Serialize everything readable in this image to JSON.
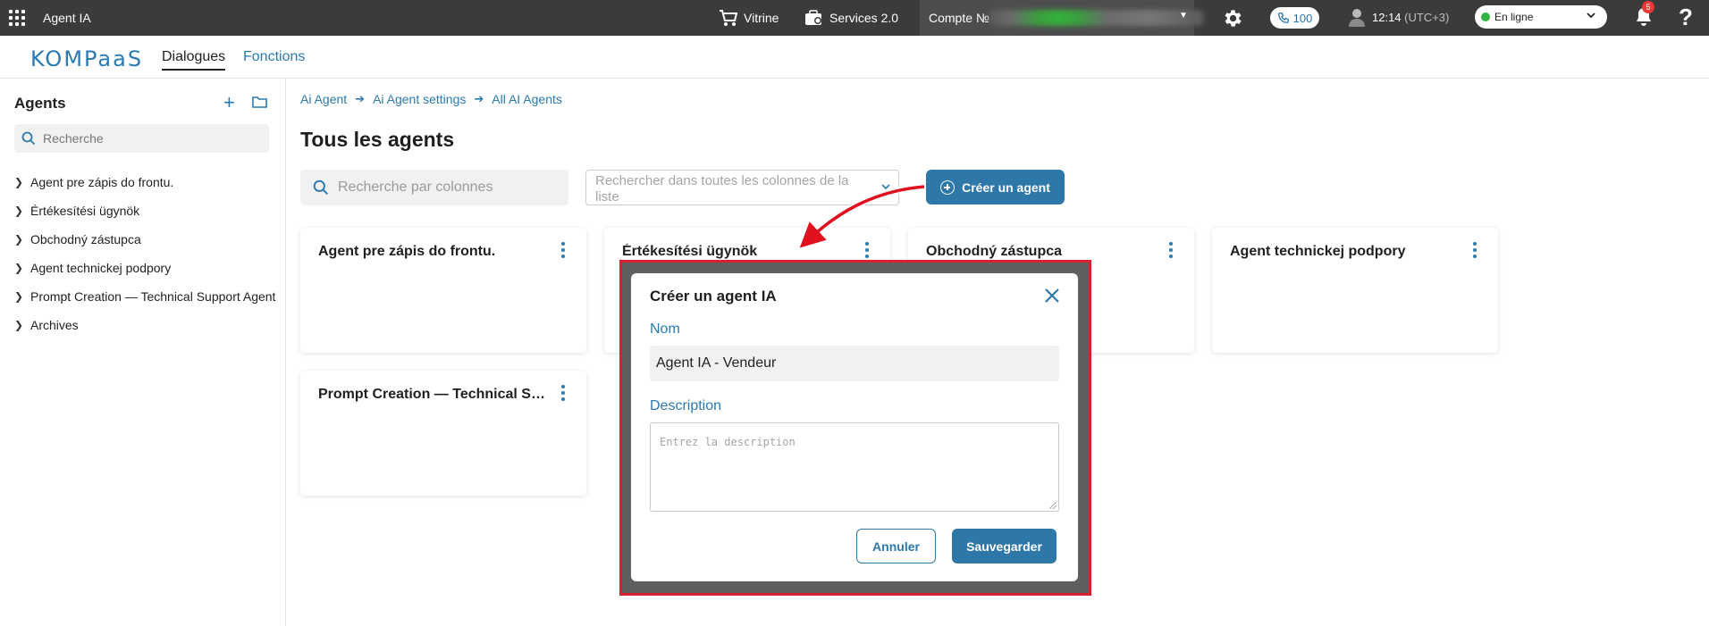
{
  "topbar": {
    "app_title": "Agent IA",
    "vitrine_label": "Vitrine",
    "services_label": "Services 2.0",
    "account_label": "Compte №",
    "phone_count": "100",
    "time": "12:14",
    "timezone": "(UTC+3)",
    "status_value": "En ligne",
    "notification_count": "5",
    "help_label": "?"
  },
  "subnav": {
    "logo_text": "KOMPaaS",
    "tabs": [
      {
        "label": "Dialogues",
        "active": true
      },
      {
        "label": "Fonctions",
        "active": false
      }
    ]
  },
  "sidebar": {
    "title": "Agents",
    "search_placeholder": "Recherche",
    "items": [
      {
        "label": "Agent pre zápis do frontu."
      },
      {
        "label": "Értékesítési ügynök"
      },
      {
        "label": "Obchodný zástupca"
      },
      {
        "label": "Agent technickej podpory"
      },
      {
        "label": "Prompt Creation — Technical Support Agent"
      },
      {
        "label": "Archives"
      }
    ]
  },
  "main": {
    "breadcrumb": [
      "Ai Agent",
      "Ai Agent settings",
      "All AI Agents"
    ],
    "page_title": "Tous les agents",
    "column_search_placeholder": "Recherche par colonnes",
    "all_columns_search_placeholder": "Rechercher dans toutes les colonnes de la liste",
    "create_button_label": "Créer un agent",
    "cards": [
      {
        "title": "Agent pre zápis do frontu."
      },
      {
        "title": "Értékesítési ügynök"
      },
      {
        "title": "Obchodný zástupca"
      },
      {
        "title": "Agent technickej podpory"
      },
      {
        "title": "Prompt Creation — Technical Sup..."
      }
    ]
  },
  "modal": {
    "title": "Créer un agent IA",
    "name_label": "Nom",
    "name_value": "Agent IA - Vendeur",
    "description_label": "Description",
    "description_placeholder": "Entrez la description",
    "cancel_label": "Annuler",
    "save_label": "Sauvegarder"
  },
  "colors": {
    "brand_blue": "#2e77a9",
    "topbar_bg": "#3b3b3b",
    "highlight_red": "#d9202e",
    "online_green": "#2fb344"
  }
}
